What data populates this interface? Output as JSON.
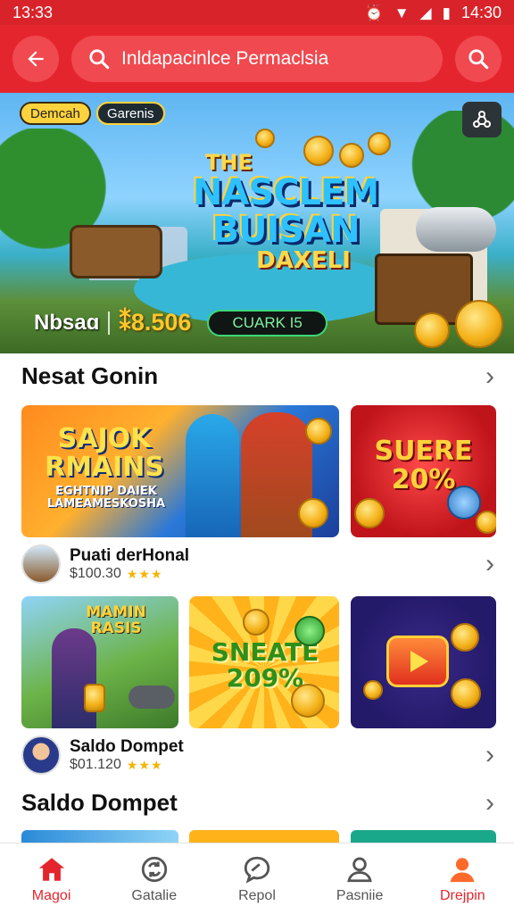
{
  "status_bar": {
    "time": "13:33",
    "right_time": "14:30"
  },
  "header": {
    "search_text": "Inldapacinlce Permaclsia"
  },
  "hero": {
    "chip_primary": "Demcah",
    "chip_secondary": "Garenis",
    "title_line1": "THE",
    "title_line2": "NASCLEM",
    "title_line3": "BUISAN",
    "title_line4": "DAXELI",
    "name": "Nbsaɑ",
    "amount": "⁑8.506",
    "code": "CUARK I5"
  },
  "section1": {
    "title": "Nesat Gonin",
    "tiles": [
      {
        "title": "SAJOK RMAINS",
        "subtitle": "EGHTNIP DAIEK LAMEAMESKOSHA"
      },
      {
        "title": "SUERE 20%"
      }
    ],
    "item": {
      "name": "Puati derHonal",
      "price": "$100.30",
      "rating": "★★★"
    }
  },
  "section2": {
    "tiles": [
      {
        "title": "MAMIN RASIS"
      },
      {
        "title": "SNEATE 209%"
      },
      {
        "title": ""
      }
    ],
    "item": {
      "name": "Saldo Dompet",
      "price": "$01.120",
      "rating": "★★★"
    }
  },
  "section3": {
    "title": "Saldo Dompet"
  },
  "bottom_nav": [
    {
      "label": "Magoi",
      "icon": "home-icon"
    },
    {
      "label": "Gatalie",
      "icon": "refresh-chat-icon"
    },
    {
      "label": "Repol",
      "icon": "chat-bubble-icon"
    },
    {
      "label": "Pasniie",
      "icon": "person-icon"
    },
    {
      "label": "Drejpin",
      "icon": "profile-icon"
    }
  ],
  "colors": {
    "brand": "#e5252d",
    "accent_green": "#3fd67a",
    "gold": "#ffc72b"
  }
}
